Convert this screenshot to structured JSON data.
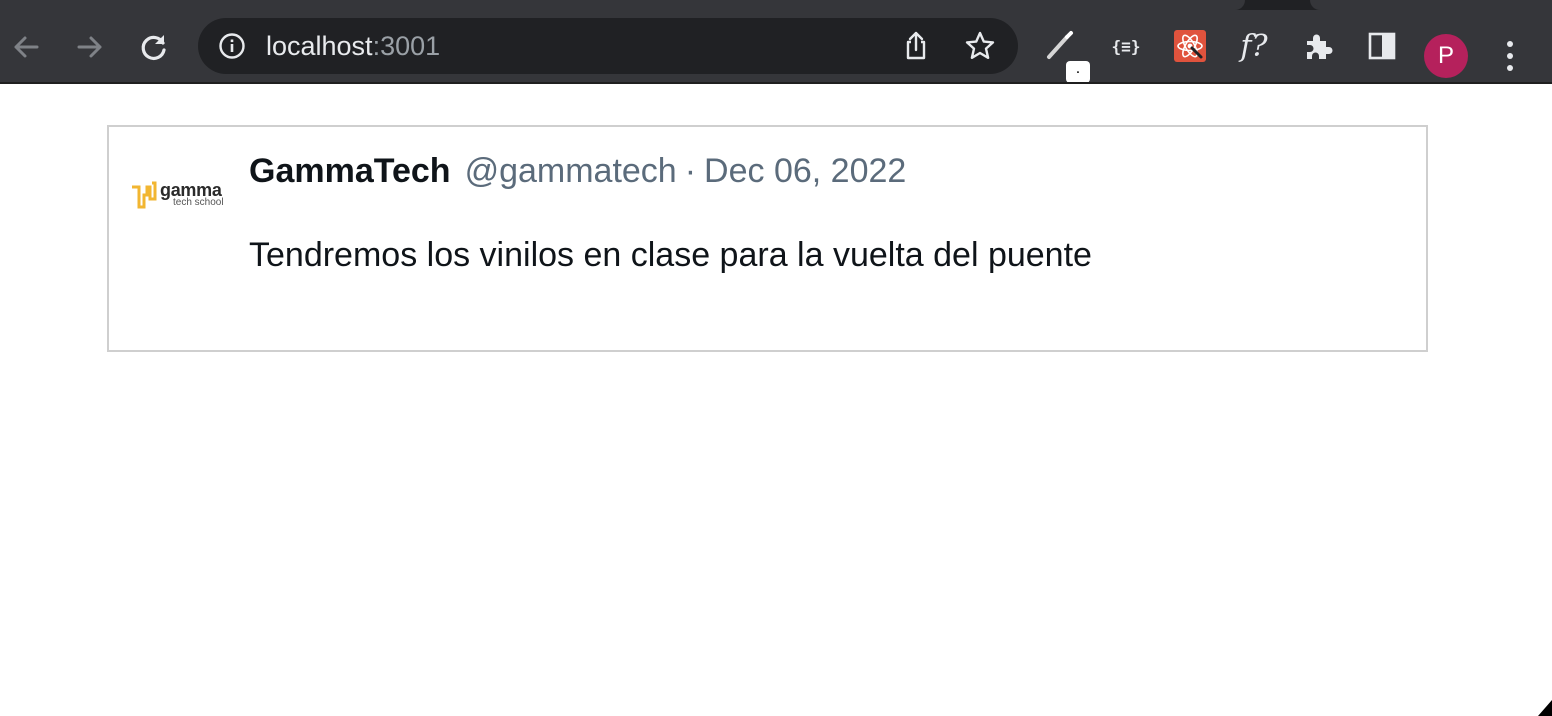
{
  "browser": {
    "url_host": "localhost",
    "url_port": ":3001",
    "extension_badge": ".",
    "extension_json_label": "{≡}",
    "extension_formula_label": "f?",
    "profile_initial": "P",
    "icons": [
      "back-arrow-icon",
      "forward-arrow-icon",
      "reload-icon",
      "info-icon",
      "share-icon",
      "star-icon",
      "eyedropper-icon",
      "json-viewer-icon",
      "react-devtools-icon",
      "formula-icon",
      "puzzle-icon",
      "side-panel-icon",
      "more-vert-icon"
    ]
  },
  "tweet": {
    "logo_word": "gamma",
    "logo_sub": "tech school",
    "name": "GammaTech",
    "handle": "@gammatech",
    "separator": "·",
    "date": "Dec 06, 2022",
    "text": "Tendremos los vinilos en clase para la vuelta del puente"
  },
  "colors": {
    "toolbar": "#35363a",
    "omnibox": "#202124",
    "avatar": "#b5215c",
    "logo_accent": "#f2b631",
    "muted_text": "#5b6b7b"
  }
}
